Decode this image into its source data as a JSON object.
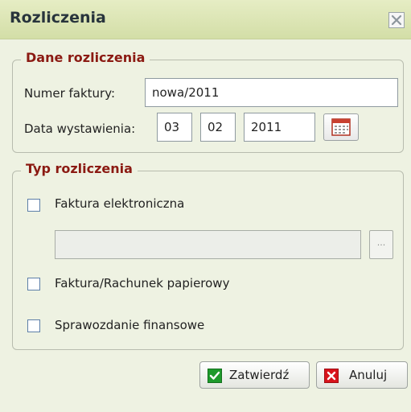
{
  "dialog": {
    "title": "Rozliczenia",
    "close_icon": "close-icon"
  },
  "billing_data": {
    "legend": "Dane rozliczenia",
    "invoice_number_label": "Numer faktury:",
    "invoice_number_value": "nowa/2011",
    "issue_date_label": "Data wystawienia:",
    "day": "03",
    "month": "02",
    "year": "2011",
    "calendar_icon": "calendar-icon"
  },
  "billing_type": {
    "legend": "Typ rozliczenia",
    "options": [
      {
        "label": "Faktura elektroniczna",
        "checked": false
      },
      {
        "label": "Faktura/Rachunek papierowy",
        "checked": false
      },
      {
        "label": "Sprawozdanie finansowe",
        "checked": false
      }
    ],
    "file_path_value": "",
    "browse_label": "..."
  },
  "footer": {
    "confirm_label": "Zatwierdź",
    "confirm_icon": "check-icon",
    "cancel_label": "Anuluj",
    "cancel_icon": "x-icon"
  },
  "colors": {
    "title_bar": "#d3dea7",
    "legend_text": "#8b1a12",
    "confirm_icon": "#1e9a2c",
    "cancel_icon": "#d8141c"
  }
}
